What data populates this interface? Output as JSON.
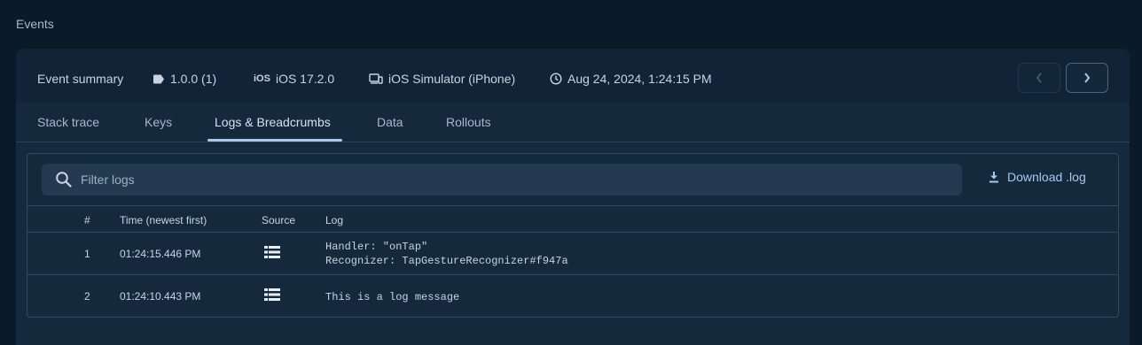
{
  "page": {
    "title": "Events"
  },
  "summary": {
    "title": "Event summary",
    "version": "1.0.0 (1)",
    "ios_badge": "iOS",
    "os": "iOS 17.2.0",
    "device": "iOS Simulator (iPhone)",
    "timestamp": "Aug 24, 2024, 1:24:15 PM"
  },
  "tabs": [
    {
      "label": "Stack trace",
      "active": false
    },
    {
      "label": "Keys",
      "active": false
    },
    {
      "label": "Logs & Breadcrumbs",
      "active": true
    },
    {
      "label": "Data",
      "active": false
    },
    {
      "label": "Rollouts",
      "active": false
    }
  ],
  "filter": {
    "placeholder": "Filter logs",
    "value": ""
  },
  "download": {
    "label": "Download .log"
  },
  "table": {
    "headers": {
      "num": "#",
      "time": "Time (newest first)",
      "source": "Source",
      "log": "Log"
    },
    "rows": [
      {
        "num": "1",
        "time": "01:24:15.446 PM",
        "log_line1": "Handler: \"onTap\"",
        "log_line2": "Recognizer: TapGestureRecognizer#f947a"
      },
      {
        "num": "2",
        "time": "01:24:10.443 PM",
        "log_line1": "This is a log message",
        "log_line2": ""
      }
    ]
  },
  "colors": {
    "accent": "#a8c8ee",
    "background": "#0a1a28",
    "card": "#15293d"
  }
}
